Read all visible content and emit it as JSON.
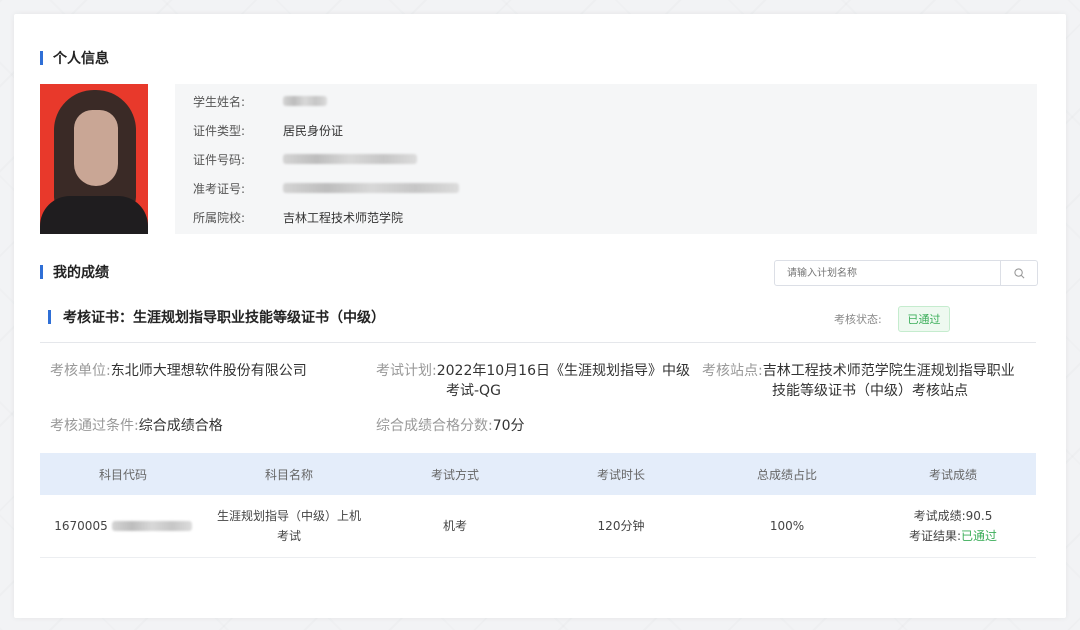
{
  "personal": {
    "title": "个人信息",
    "fields": [
      {
        "label": "学生姓名:",
        "value": ""
      },
      {
        "label": "证件类型:",
        "value": "居民身份证"
      },
      {
        "label": "证件号码:",
        "value": ""
      },
      {
        "label": "准考证号:",
        "value": ""
      },
      {
        "label": "所属院校:",
        "value": "吉林工程技术师范学院"
      }
    ]
  },
  "scores": {
    "title": "我的成绩",
    "search_placeholder": "请输入计划名称"
  },
  "certificate": {
    "title": "考核证书：生涯规划指导职业技能等级证书（中级）",
    "status_label": "考核状态:",
    "status_value": "已通过",
    "unit_label": "考核单位:",
    "unit_value": "东北师大理想软件股份有限公司",
    "plan_label": "考试计划:",
    "plan_value_line1": "2022年10月16日《生涯规划指导》中级",
    "plan_value_line2": "考试-QG",
    "site_label": "考核站点:",
    "site_value_line1": "吉林工程技术师范学院生涯规划指导职业",
    "site_value_line2": "技能等级证书（中级）考核站点",
    "condition_label": "考核通过条件:",
    "condition_value": "综合成绩合格",
    "pass_score_label": "综合成绩合格分数:",
    "pass_score_value": "70分"
  },
  "table": {
    "headers": [
      "科目代码",
      "科目名称",
      "考试方式",
      "考试时长",
      "总成绩占比",
      "考试成绩"
    ],
    "rows": [
      {
        "code": "1670005",
        "name_line1": "生涯规划指导（中级）上机",
        "name_line2": "考试",
        "method": "机考",
        "duration": "120分钟",
        "ratio": "100%",
        "score_label": "考试成绩:",
        "score_value": "90.5",
        "result_label": "考证结果:",
        "result_value": "已通过"
      }
    ]
  },
  "colors": {
    "accent": "#2f6fd6",
    "pass": "#3cae5a",
    "table_header_bg": "#e4edfa"
  }
}
